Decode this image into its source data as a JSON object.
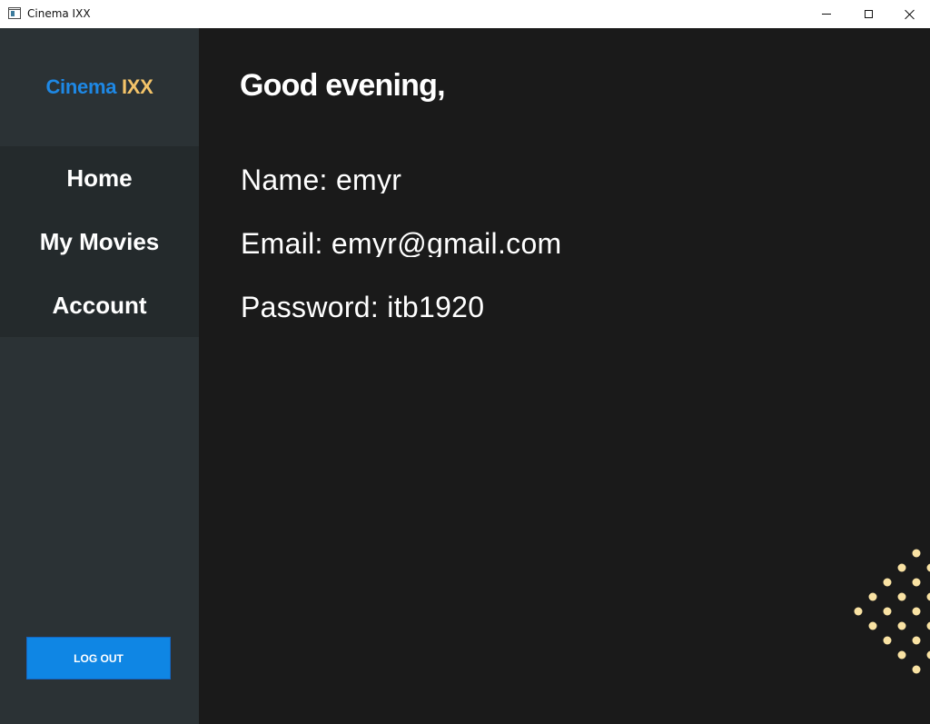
{
  "window": {
    "title": "Cinema IXX",
    "icon": "app-window-icon",
    "controls": [
      "minimize-icon",
      "maximize-icon",
      "close-icon"
    ]
  },
  "sidebar": {
    "logo": {
      "part1": "Cinema",
      "part2": "IXX"
    },
    "nav": [
      {
        "label": "Home"
      },
      {
        "label": "My Movies"
      },
      {
        "label": "Account"
      }
    ],
    "logout_label": "LOG OUT"
  },
  "main": {
    "greeting": "Good evening,",
    "name_line": "Name: emyr",
    "email_line": "Email: emyr@gmail.com",
    "password_line": "Password: itb1920"
  },
  "colors": {
    "sidebar_bg": "#2b3235",
    "nav_bg": "#242a2c",
    "main_bg": "#1a1a1a",
    "accent_blue": "#1e88e5",
    "accent_gold": "#f4c469",
    "button_blue": "#0f86e4",
    "dot_color": "#f9e2a3"
  }
}
